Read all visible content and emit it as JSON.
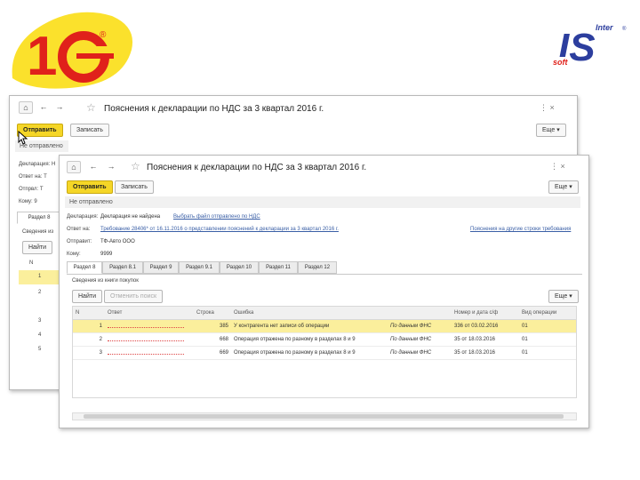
{
  "logos": {
    "left_text": "1С",
    "right_top": "Inter",
    "right_main": "IS",
    "right_bottom": "soft"
  },
  "colors": {
    "accent_yellow": "#f5d627",
    "logo_red": "#e0211b",
    "logo_yellow": "#fbe12c",
    "logo_blue": "#2c3e9e",
    "link": "#3a5fa6"
  },
  "back_window": {
    "nav": [
      "⌂",
      "←",
      "→"
    ],
    "star": "☆",
    "title": "Пояснения к декларации по НДС за 3 квартал 2016 г.",
    "controls": "⋮   ×",
    "send_button": "Отправить",
    "save_button": "Записать",
    "more_button": "Еще ▾",
    "status": "Не отправлено",
    "fields": [
      "Декларация: Н",
      "Ответ на:  Т",
      "Отпрвл:   Т",
      "Кому:     9"
    ],
    "tabs": [
      "Раздел 8"
    ],
    "section_label": "Сведения из",
    "find_button": "Найти",
    "row_header": "N",
    "row_numbers": [
      "1",
      "2",
      "3",
      "4",
      "5"
    ]
  },
  "front_window": {
    "nav": [
      "⌂",
      "←",
      "→"
    ],
    "star": "☆",
    "title": "Пояснения к декларации по НДС за 3 квартал 2016 г.",
    "controls": "⋮   ×",
    "send_button": "Отправить",
    "save_button": "Записать",
    "more_button": "Еще ▾",
    "status": "Не отправлено",
    "declaration_label": "Декларация:",
    "declaration_value": "Декларация не найдена",
    "declaration_link": "Выбрать файл отправлено по НДС",
    "reply_label": "Ответ на:",
    "reply_link": "Требование 28406* от 16.11.2016 о представлении пояснений к декларации за 3 квартал 2016 г.",
    "other_link": "Пояснения на другие строки требования",
    "from_label": "Отправит:",
    "from_value": "ТФ-Авто ООО",
    "to_label": "Кому:",
    "to_value": "9999",
    "tabs": [
      "Раздел 8",
      "Раздел 8.1",
      "Раздел 9",
      "Раздел 9.1",
      "Раздел 10",
      "Раздел 11",
      "Раздел 12"
    ],
    "section_label": "Сведения из книги покупок",
    "find_button": "Найти",
    "cancel_find_button": "Отменить поиск",
    "table_more_button": "Еще ▾",
    "table": {
      "headers": [
        "N",
        "Ответ",
        "Строка",
        "Ошибка",
        "",
        "Номер и дата с/ф",
        "Вид операции"
      ],
      "rows": [
        {
          "n": "1",
          "line": "385",
          "error": "У контрагента нет записи об операции",
          "source": "По данным ФНС",
          "invoice": "336 от 03.02.2016",
          "op": "01"
        },
        {
          "n": "2",
          "line": "668",
          "error": "Операция отражена по разному в разделах 8 и 9",
          "source": "По данным ФНС",
          "invoice": "35 от 18.03.2016",
          "op": "01"
        },
        {
          "n": "3",
          "line": "669",
          "error": "Операция отражена по разному в разделах 8 и 9",
          "source": "По данным ФНС",
          "invoice": "35 от 18.03.2016",
          "op": "01"
        }
      ]
    }
  }
}
